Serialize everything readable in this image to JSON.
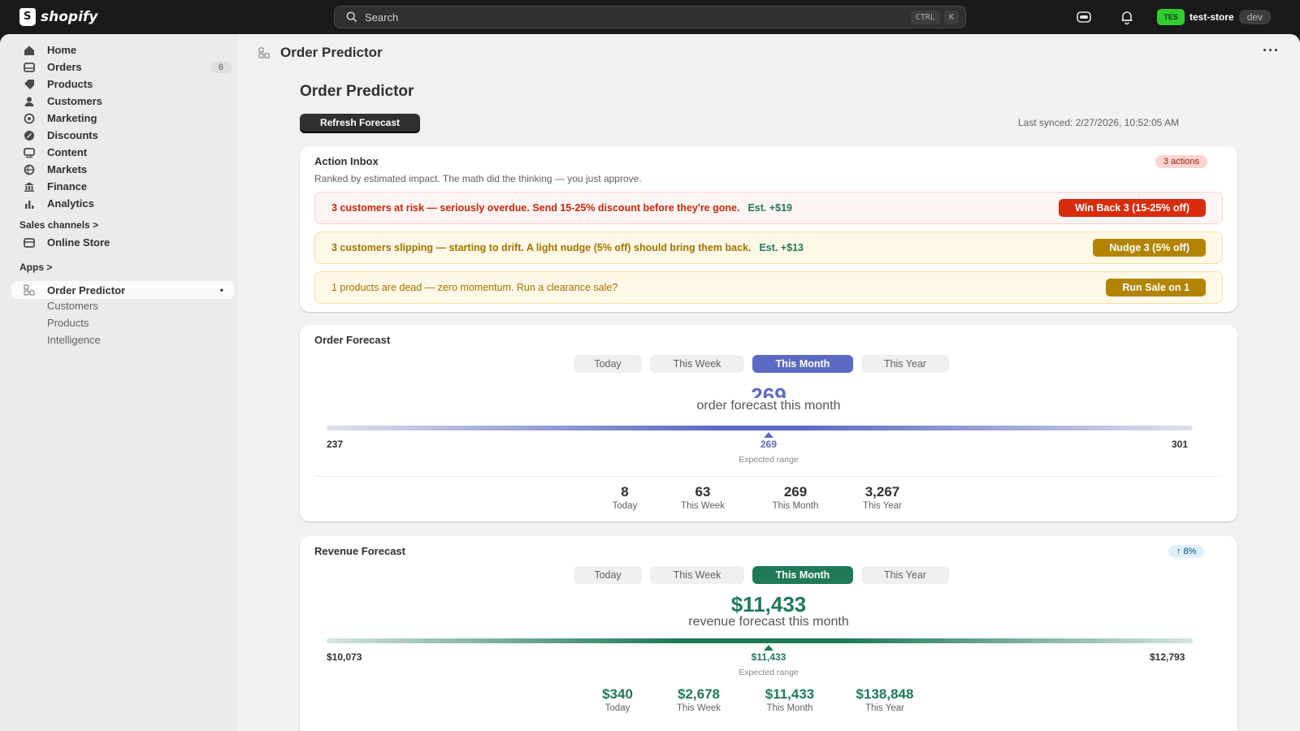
{
  "topbar": {
    "brand": "shopify",
    "search_placeholder": "Search",
    "kbd1": "CTRL",
    "kbd2": "K",
    "store_avatar": "TES",
    "store_name": "test-store",
    "env_tag": "dev",
    "icons": [
      "search-icon",
      "sidekick-icon",
      "bell-icon"
    ]
  },
  "sidebar": {
    "items": [
      {
        "label": "Home",
        "icon": "home-icon"
      },
      {
        "label": "Orders",
        "icon": "inbox-icon",
        "count": "6"
      },
      {
        "label": "Products",
        "icon": "tag-icon"
      },
      {
        "label": "Customers",
        "icon": "person-icon"
      },
      {
        "label": "Marketing",
        "icon": "target-icon"
      },
      {
        "label": "Discounts",
        "icon": "discount-icon"
      },
      {
        "label": "Content",
        "icon": "content-icon"
      },
      {
        "label": "Markets",
        "icon": "globe-icon"
      },
      {
        "label": "Finance",
        "icon": "bank-icon"
      },
      {
        "label": "Analytics",
        "icon": "bar-chart-icon"
      }
    ],
    "sales_channels": "Sales channels",
    "online_store": "Online Store",
    "apps": "Apps",
    "app_name": "Order Predictor",
    "app_subitems": [
      "Customers",
      "Products",
      "Intelligence"
    ]
  },
  "page": {
    "breadcrumb_title": "Order Predictor",
    "heading": "Order Predictor",
    "refresh_label": "Refresh Forecast",
    "last_synced": "Last synced: 2/27/2026, 10:52:05 AM"
  },
  "inbox": {
    "title": "Action Inbox",
    "badge": "3 actions",
    "description": "Ranked by estimated impact. The math did the thinking — you just approve.",
    "rows": [
      {
        "text": "3 customers at risk — seriously overdue. Send 15-25% discount before they're gone.",
        "est": "Est. +$19",
        "button": "Win Back 3 (15-25% off)"
      },
      {
        "text": "3 customers slipping — starting to drift. A light nudge (5% off) should bring them back.",
        "est": "Est. +$13",
        "button": "Nudge 3 (5% off)"
      },
      {
        "text": "1 products are dead — zero momentum. Run a clearance sale?",
        "est": "",
        "button": "Run Sale on 1"
      }
    ]
  },
  "order_forecast": {
    "title": "Order Forecast",
    "tabs": [
      "Today",
      "This Week",
      "This Month",
      "This Year"
    ],
    "active_tab": "This Month",
    "value": "269",
    "subtitle": "order forecast this month",
    "range_low": "237",
    "range_mid": "269",
    "range_high": "301",
    "range_caption": "Expected range",
    "stats": [
      {
        "value": "8",
        "label": "Today"
      },
      {
        "value": "63",
        "label": "This Week"
      },
      {
        "value": "269",
        "label": "This Month"
      },
      {
        "value": "3,267",
        "label": "This Year"
      }
    ]
  },
  "revenue_forecast": {
    "title": "Revenue Forecast",
    "badge": "↑ 8%",
    "tabs": [
      "Today",
      "This Week",
      "This Month",
      "This Year"
    ],
    "active_tab": "This Month",
    "value": "$11,433",
    "subtitle": "revenue forecast this month",
    "range_low": "$10,073",
    "range_mid": "$11,433",
    "range_high": "$12,793",
    "range_caption": "Expected range",
    "stats": [
      {
        "value": "$340",
        "label": "Today"
      },
      {
        "value": "$2,678",
        "label": "This Week"
      },
      {
        "value": "$11,433",
        "label": "This Month"
      },
      {
        "value": "$138,848",
        "label": "This Year"
      }
    ]
  },
  "colors": {
    "order_accent": "#5c6ac4",
    "revenue_accent": "#1f7a55",
    "danger": "#d82c0d",
    "warning": "#b28400"
  }
}
